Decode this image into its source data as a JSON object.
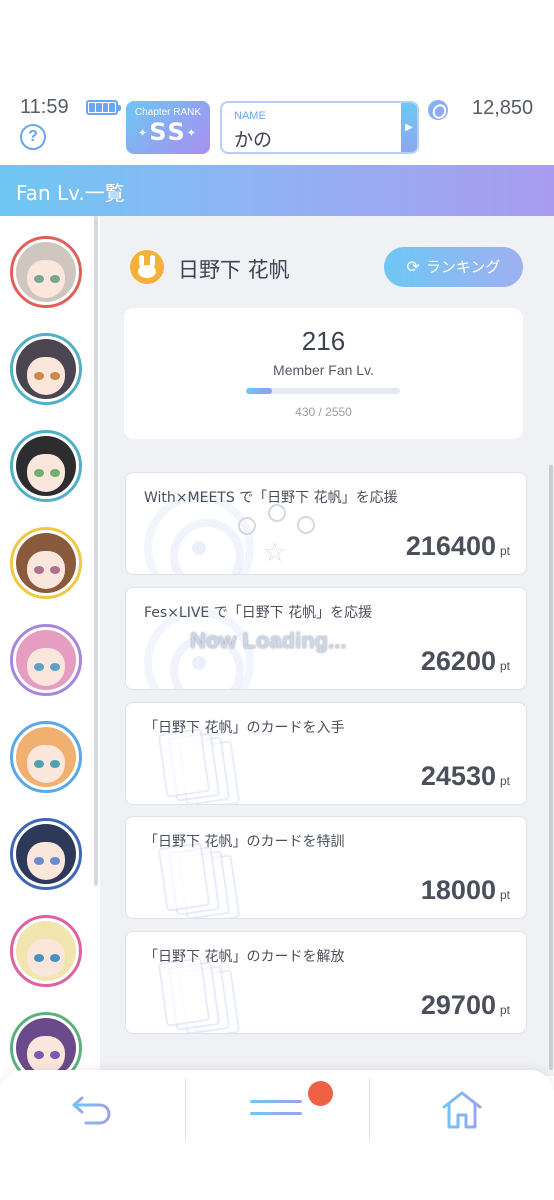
{
  "status": {
    "time": "11:59",
    "coins": "12,850"
  },
  "rank": {
    "label": "Chapter RANK",
    "value": "SS"
  },
  "player": {
    "name_label": "NAME",
    "name": "かの"
  },
  "page": {
    "title": "Fan Lv.一覧"
  },
  "member": {
    "name": "日野下 花帆",
    "ranking_button": "ランキング",
    "fan_level": "216",
    "fan_level_label": "Member Fan Lv.",
    "progress_text": "430 / 2550",
    "progress_fraction": 0.169
  },
  "records": [
    {
      "title": "With×MEETS で「日野下 花帆」を応援",
      "value": "216400",
      "unit": "pt",
      "icon": "radio-wave-icon"
    },
    {
      "title": "Fes×LIVE で「日野下 花帆」を応援",
      "value": "26200",
      "unit": "pt",
      "icon": "radio-wave-icon"
    },
    {
      "title": "「日野下 花帆」のカードを入手",
      "value": "24530",
      "unit": "pt",
      "icon": "cards-icon"
    },
    {
      "title": "「日野下 花帆」のカードを特訓",
      "value": "18000",
      "unit": "pt",
      "icon": "cards-icon"
    },
    {
      "title": "「日野下 花帆」のカードを解放",
      "value": "29700",
      "unit": "pt",
      "icon": "cards-icon"
    }
  ],
  "loading_text": "Now Loading...",
  "avatars": [
    {
      "ring": "#e0605a",
      "hair": "#cfc7bf",
      "eye": "#7aa58e"
    },
    {
      "ring": "#4fb0c6",
      "hair": "#4a4550",
      "eye": "#c98a4e"
    },
    {
      "ring": "#4fb0c6",
      "hair": "#2d2d30",
      "eye": "#6fb06a"
    },
    {
      "ring": "#f0c845",
      "hair": "#8a5a3c",
      "eye": "#b07090"
    },
    {
      "ring": "#a886e0",
      "hair": "#e59ec2",
      "eye": "#5aa0c8"
    },
    {
      "ring": "#5aa8e8",
      "hair": "#f0b070",
      "eye": "#4fa2b0"
    },
    {
      "ring": "#3f66b8",
      "hair": "#2e3858",
      "eye": "#6a8ad0"
    },
    {
      "ring": "#e060a0",
      "hair": "#f2e6b0",
      "eye": "#4a90c0"
    },
    {
      "ring": "#5cb080",
      "hair": "#6a4a8a",
      "eye": "#7a5ab0"
    }
  ],
  "colors": {
    "accent": "#6ec7f3",
    "accent2": "#a99cf0",
    "badge": "#ef6044",
    "member_icon": "#f3b13a"
  }
}
